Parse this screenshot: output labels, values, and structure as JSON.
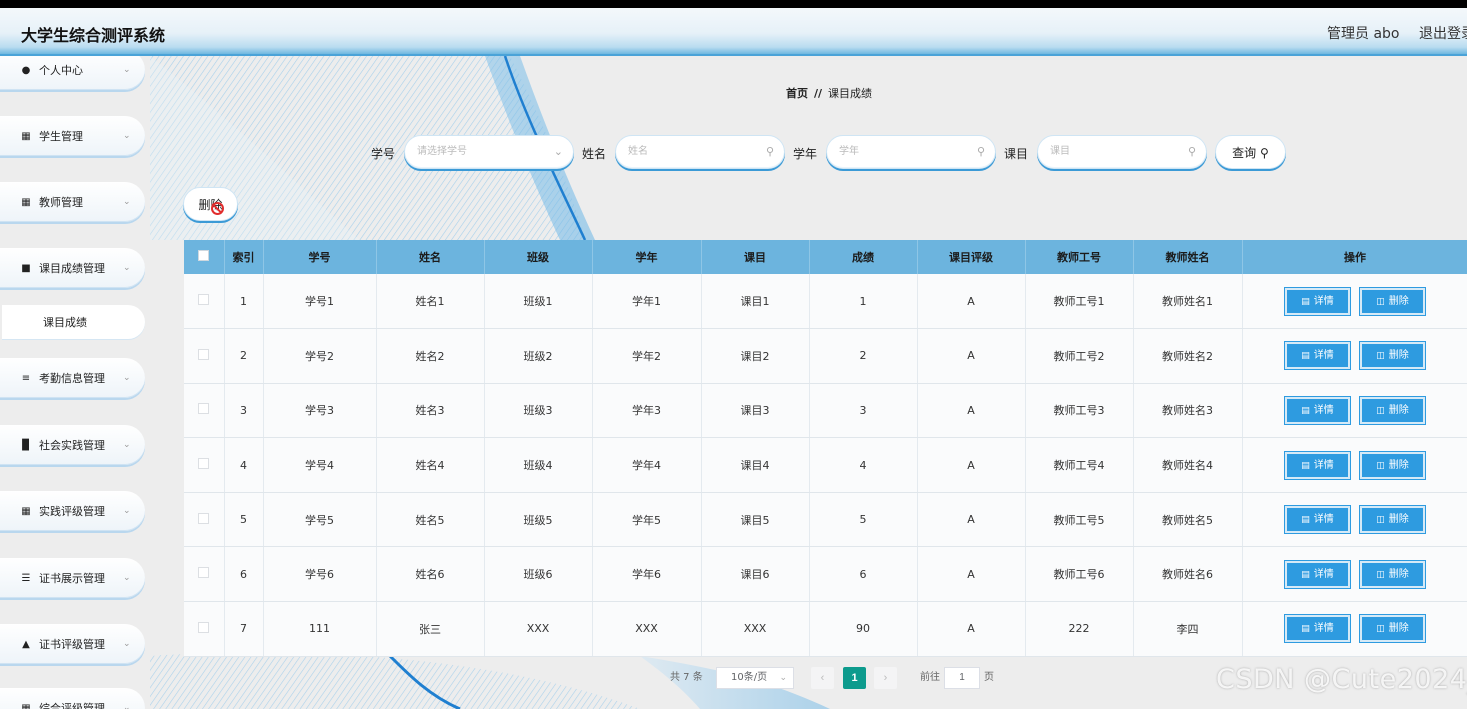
{
  "header": {
    "app_title": "大学生综合测评系统",
    "admin": "管理员 abo",
    "logout": "退出登录"
  },
  "sidebar": {
    "items": [
      {
        "icon": "user-icon",
        "label": "个人中心"
      },
      {
        "icon": "grid-icon",
        "label": "学生管理"
      },
      {
        "icon": "grid-icon",
        "label": "教师管理"
      },
      {
        "icon": "comment-icon",
        "label": "课目成绩管理"
      },
      {
        "icon": "sliders-icon",
        "label": "考勤信息管理"
      },
      {
        "icon": "books-icon",
        "label": "社会实践管理"
      },
      {
        "icon": "grid-icon",
        "label": "实践评级管理"
      },
      {
        "icon": "list-icon",
        "label": "证书展示管理"
      },
      {
        "icon": "lock-icon",
        "label": "证书评级管理"
      },
      {
        "icon": "grid-icon",
        "label": "综合评级管理"
      }
    ],
    "sub_item": "课目成绩"
  },
  "breadcrumb": {
    "home": "首页",
    "sep": "//",
    "current": "课目成绩"
  },
  "search": {
    "fields": [
      {
        "label": "学号",
        "placeholder": "请选择学号",
        "icon": "chevron-down-icon"
      },
      {
        "label": "姓名",
        "placeholder": "姓名",
        "icon": "search-icon"
      },
      {
        "label": "学年",
        "placeholder": "学年",
        "icon": "search-icon"
      },
      {
        "label": "课目",
        "placeholder": "课目",
        "icon": "search-icon"
      }
    ],
    "query_button": "查询",
    "delete_button": "删除"
  },
  "table": {
    "columns": [
      "索引",
      "学号",
      "姓名",
      "班级",
      "学年",
      "课目",
      "成绩",
      "课目评级",
      "教师工号",
      "教师姓名",
      "操作"
    ],
    "rows": [
      [
        "1",
        "学号1",
        "姓名1",
        "班级1",
        "学年1",
        "课目1",
        "1",
        "A",
        "教师工号1",
        "教师姓名1"
      ],
      [
        "2",
        "学号2",
        "姓名2",
        "班级2",
        "学年2",
        "课目2",
        "2",
        "A",
        "教师工号2",
        "教师姓名2"
      ],
      [
        "3",
        "学号3",
        "姓名3",
        "班级3",
        "学年3",
        "课目3",
        "3",
        "A",
        "教师工号3",
        "教师姓名3"
      ],
      [
        "4",
        "学号4",
        "姓名4",
        "班级4",
        "学年4",
        "课目4",
        "4",
        "A",
        "教师工号4",
        "教师姓名4"
      ],
      [
        "5",
        "学号5",
        "姓名5",
        "班级5",
        "学年5",
        "课目5",
        "5",
        "A",
        "教师工号5",
        "教师姓名5"
      ],
      [
        "6",
        "学号6",
        "姓名6",
        "班级6",
        "学年6",
        "课目6",
        "6",
        "A",
        "教师工号6",
        "教师姓名6"
      ],
      [
        "7",
        "111",
        "张三",
        "XXX",
        "XXX",
        "XXX",
        "90",
        "A",
        "222",
        "李四"
      ]
    ],
    "detail_label": "详情",
    "delete_label": "删除"
  },
  "pagination": {
    "total": "共 7 条",
    "page_size": "10条/页",
    "current_page": "1",
    "goto_label": "前往",
    "goto_value": "1",
    "page_unit": "页"
  },
  "watermark": "CSDN @Cute2024_",
  "colors": {
    "accent": "#2e9be0",
    "table_header": "#6cb4de",
    "current_page": "#0d9b8d",
    "danger": "#e12d2d"
  }
}
